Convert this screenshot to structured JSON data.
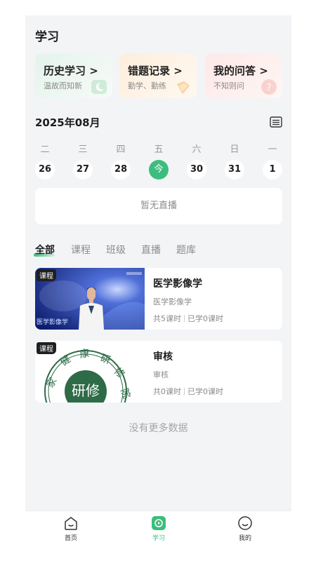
{
  "page": {
    "title": "学习"
  },
  "quick_cards": [
    {
      "title": "历史学习 >",
      "subtitle": "温故而知新"
    },
    {
      "title": "错题记录 >",
      "subtitle": "勤学、勤练"
    },
    {
      "title": "我的问答 >",
      "subtitle": "不知则问"
    }
  ],
  "calendar": {
    "month": "2025年08月",
    "weekdays": [
      "二",
      "三",
      "四",
      "五",
      "六",
      "日",
      "一"
    ],
    "dates": [
      "26",
      "27",
      "28",
      "今",
      "30",
      "31",
      "1"
    ]
  },
  "live": {
    "empty_text": "暂无直播"
  },
  "tabs": [
    "全部",
    "课程",
    "班级",
    "直播",
    "题库"
  ],
  "courses": [
    {
      "badge": "课程",
      "title": "医学影像学",
      "subtitle": "医学影像学",
      "lessons_total": "共5课时",
      "lessons_done": "已学0课时",
      "thumb_caption": "医学影像学"
    },
    {
      "badge": "课程",
      "title": "审核",
      "subtitle": "审核",
      "lessons_total": "共0课时",
      "lessons_done": "已学0课时",
      "seal_chars": [
        "家",
        "健",
        "康",
        "研",
        "修",
        "院"
      ],
      "seal_center": "研修"
    }
  ],
  "list_end_text": "没有更多数据",
  "bottom_nav": [
    {
      "label": "首页",
      "icon": "home-icon"
    },
    {
      "label": "学习",
      "icon": "study-icon"
    },
    {
      "label": "我的",
      "icon": "profile-icon"
    }
  ],
  "colors": {
    "accent": "#3dbd7d",
    "background": "#f3f4f6"
  }
}
